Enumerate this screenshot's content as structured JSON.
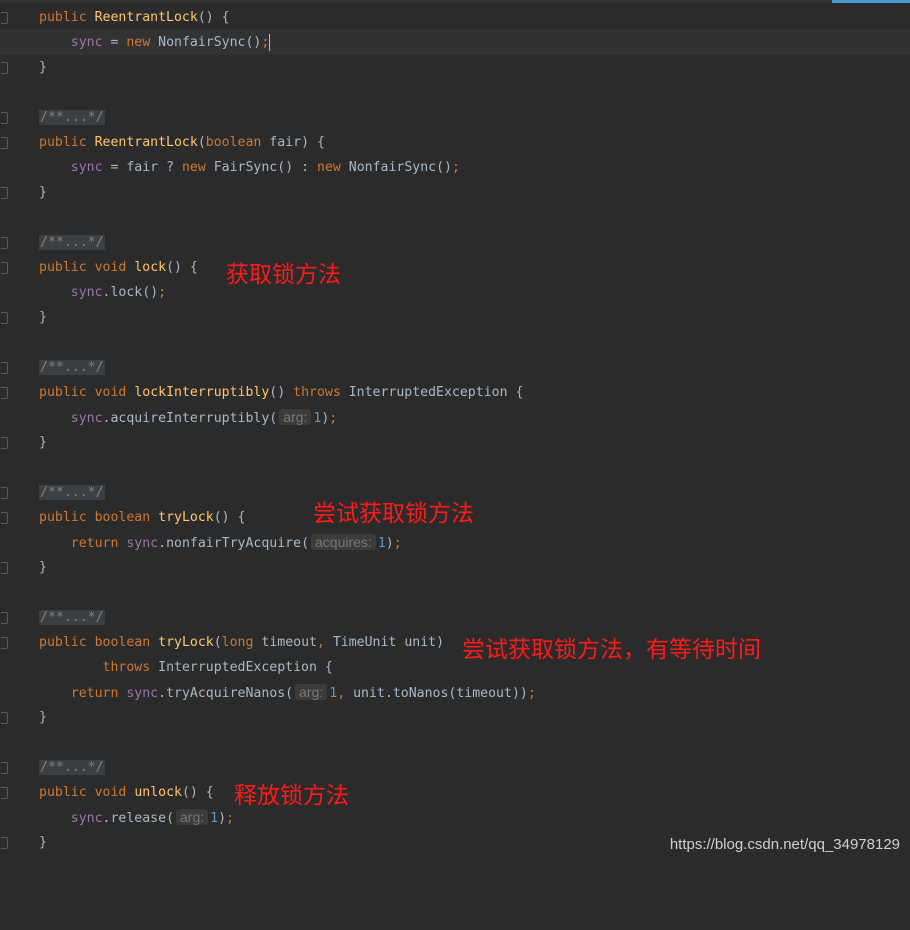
{
  "editor": {
    "theme_background": "#2b2b2b",
    "colors": {
      "keyword": "#cc7832",
      "method": "#ffc66d",
      "field": "#9876aa",
      "number": "#6897bb",
      "comment": "#808080",
      "annotation": "#ff1a1a"
    },
    "code": {
      "kw_public": "public",
      "kw_void": "void",
      "kw_boolean": "boolean",
      "kw_new": "new",
      "kw_return": "return",
      "kw_throws": "throws",
      "kw_long": "long",
      "ctor_name": "ReentrantLock",
      "field_sync": "sync",
      "fold_comment": "/**...*/",
      "nonfair_sync": "NonfairSync",
      "fair_sync": "FairSync",
      "param_fair": "fair",
      "m_lock": "lock",
      "m_lock_interruptibly": "lockInterruptibly",
      "interrupted_exception": "InterruptedException",
      "m_acquire_interruptibly": "acquireInterruptibly",
      "m_try_lock": "tryLock",
      "m_nonfair_try_acquire": "nonfairTryAcquire",
      "param_timeout": "timeout",
      "type_time_unit": "TimeUnit",
      "param_unit": "unit",
      "m_try_acquire_nanos": "tryAcquireNanos",
      "m_to_nanos": "toNanos",
      "m_unlock": "unlock",
      "m_release": "release",
      "hint_arg": "arg:",
      "hint_acquires": "acquires:",
      "num_one": "1"
    },
    "annotations": {
      "lock": "获取锁方法",
      "try_lock": "尝试获取锁方法",
      "try_lock_timed": "尝试获取锁方法，有等待时间",
      "unlock": "释放锁方法"
    },
    "watermark": "https://blog.csdn.net/qq_34978129"
  }
}
